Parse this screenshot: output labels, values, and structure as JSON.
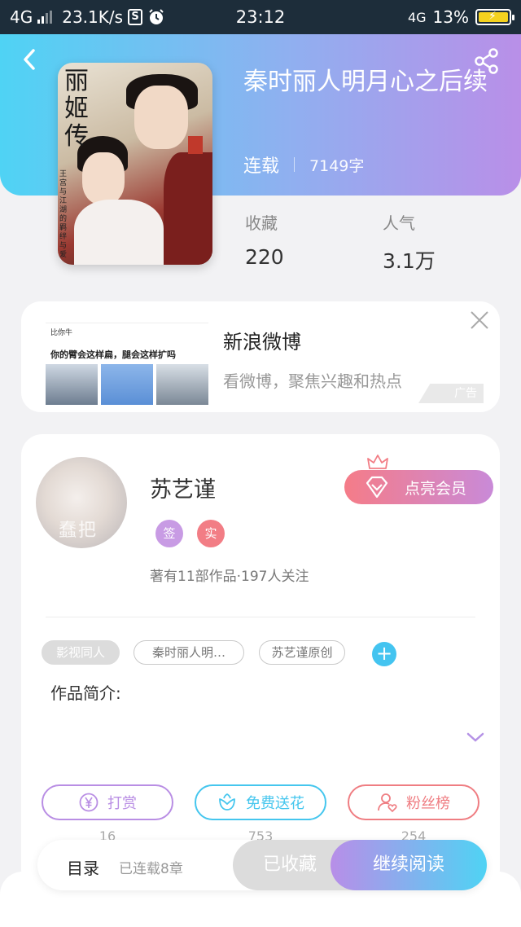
{
  "status_bar": {
    "network": "4G",
    "speed": "23.1K/s",
    "s_glyph": "S",
    "time": "23:12",
    "network_right": "4G",
    "battery": "13%"
  },
  "book": {
    "title": "秦时丽人明月心之后续",
    "status": "连载",
    "word_count": "7149字",
    "stats": [
      {
        "label": "收藏",
        "value": "220"
      },
      {
        "label": "人气",
        "value": "3.1万"
      }
    ],
    "cover": {
      "title_text": "丽姬传",
      "small_text": "王宫与江湖的羁绊与爱"
    }
  },
  "ad": {
    "title": "新浪微博",
    "subtitle": "看微博，聚焦兴趣和热点",
    "badge": "广告",
    "thumb_user": "比你牛",
    "thumb_text": "你的臂会这样扁，腿会这样扩吗"
  },
  "author": {
    "name": "苏艺谨",
    "avatar_watermark": "蠢把",
    "badges": [
      {
        "text": "签",
        "color": "#c89be4"
      },
      {
        "text": "实",
        "color": "#f27d85"
      }
    ],
    "stats_text": "著有11部作品·197人关注",
    "vip_label": "点亮会员"
  },
  "tags": [
    {
      "text": "影视同人",
      "style": "solid"
    },
    {
      "text": "秦时丽人明…",
      "style": "outline"
    },
    {
      "text": "苏艺谨原创",
      "style": "outline"
    }
  ],
  "add_tag_symbol": "+",
  "intro": {
    "title": "作品简介:"
  },
  "actions": [
    {
      "label": "打赏",
      "count": "16",
      "color": "#b98ee4",
      "icon": "yen-icon"
    },
    {
      "label": "免费送花",
      "count": "753",
      "color": "#45c6ee",
      "icon": "flower-icon"
    },
    {
      "label": "粉丝榜",
      "count": "254",
      "color": "#ef7d82",
      "icon": "fan-icon"
    }
  ],
  "bottom_bar": {
    "toc_label": "目录",
    "chapter_count": "已连载8章",
    "favorite_label": "已收藏",
    "read_label": "继续阅读"
  },
  "colors": {
    "header_gradient": [
      "#4fd3f4",
      "#b98fe8"
    ],
    "accent_blue": "#44c4f0",
    "accent_purple": "#b98ee4",
    "accent_pink": "#f27d85"
  }
}
